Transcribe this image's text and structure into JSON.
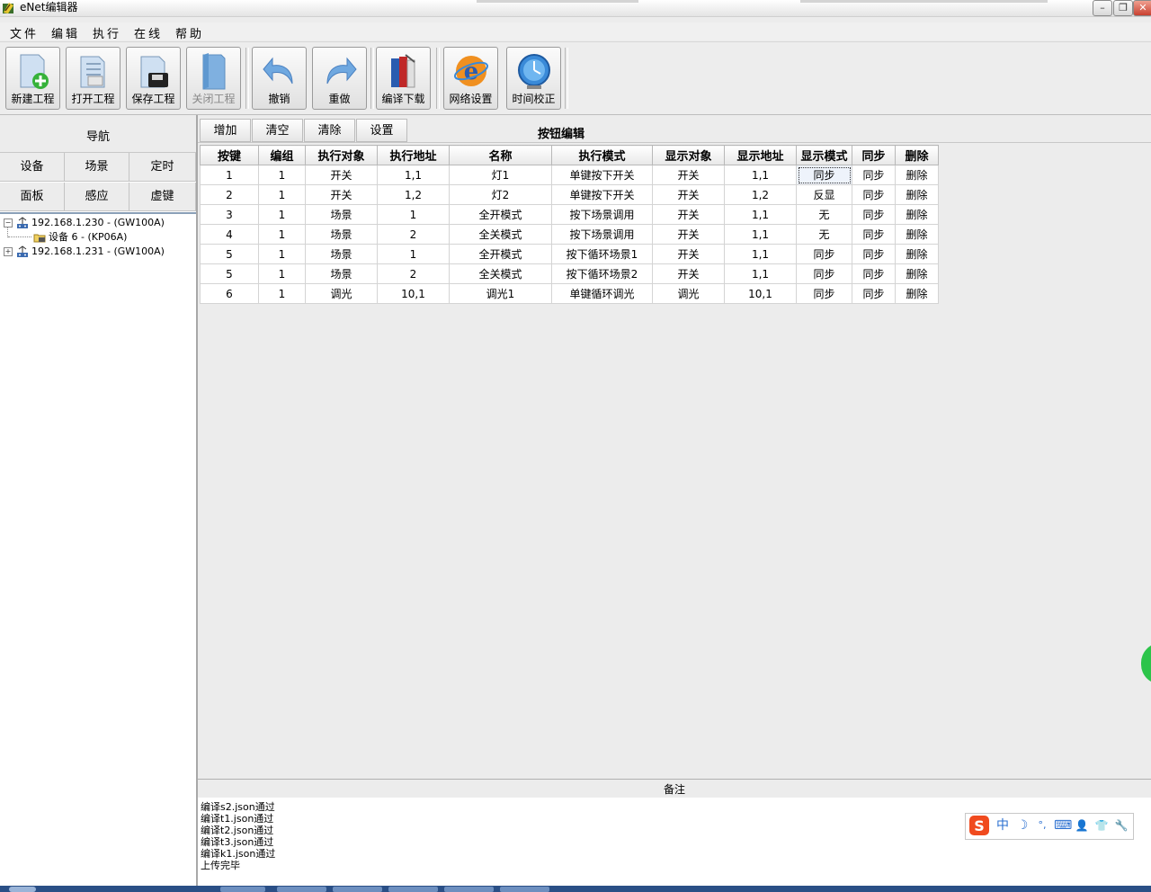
{
  "window": {
    "title": "eNet编辑器",
    "minimize": "–",
    "restore": "❐",
    "close": "✕"
  },
  "menu": [
    "文件",
    "编辑",
    "执行",
    "在线",
    "帮助"
  ],
  "toolbar": [
    {
      "label": "新建工程",
      "icon": "new-project-icon",
      "enabled": true
    },
    {
      "label": "打开工程",
      "icon": "open-project-icon",
      "enabled": true
    },
    {
      "label": "保存工程",
      "icon": "save-project-icon",
      "enabled": true
    },
    {
      "label": "关闭工程",
      "icon": "close-project-icon",
      "enabled": false
    },
    {
      "label": "撤销",
      "icon": "undo-icon",
      "enabled": true
    },
    {
      "label": "重做",
      "icon": "redo-icon",
      "enabled": true
    },
    {
      "label": "编译下载",
      "icon": "compile-download-icon",
      "enabled": true
    },
    {
      "label": "网络设置",
      "icon": "network-settings-icon",
      "enabled": true
    },
    {
      "label": "时间校正",
      "icon": "time-calibration-icon",
      "enabled": true
    }
  ],
  "nav": {
    "title": "导航",
    "buttons": [
      "设备",
      "场景",
      "定时",
      "面板",
      "感应",
      "虚键"
    ]
  },
  "tree": [
    {
      "label": "192.168.1.230 - (GW100A)",
      "expander": "−",
      "icon": "gateway-icon"
    },
    {
      "label": "设备 6 - (KP06A)",
      "icon": "device-folder-icon"
    },
    {
      "label": "192.168.1.231 - (GW100A)",
      "expander": "+",
      "icon": "gateway-icon"
    }
  ],
  "editor": {
    "tabs": [
      "增加",
      "清空",
      "清除",
      "设置"
    ],
    "title": "按钮编辑",
    "columns": [
      "按键",
      "编组",
      "执行对象",
      "执行地址",
      "名称",
      "执行模式",
      "显示对象",
      "显示地址",
      "显示模式",
      "同步",
      "删除"
    ],
    "rows": [
      [
        "1",
        "1",
        "开关",
        "1,1",
        "灯1",
        "单键按下开关",
        "开关",
        "1,1",
        "同步",
        "同步",
        "删除"
      ],
      [
        "2",
        "1",
        "开关",
        "1,2",
        "灯2",
        "单键按下开关",
        "开关",
        "1,2",
        "反显",
        "同步",
        "删除"
      ],
      [
        "3",
        "1",
        "场景",
        "1",
        "全开模式",
        "按下场景调用",
        "开关",
        "1,1",
        "无",
        "同步",
        "删除"
      ],
      [
        "4",
        "1",
        "场景",
        "2",
        "全关模式",
        "按下场景调用",
        "开关",
        "1,1",
        "无",
        "同步",
        "删除"
      ],
      [
        "5",
        "1",
        "场景",
        "1",
        "全开模式",
        "按下循环场景1",
        "开关",
        "1,1",
        "同步",
        "同步",
        "删除"
      ],
      [
        "5",
        "1",
        "场景",
        "2",
        "全关模式",
        "按下循环场景2",
        "开关",
        "1,1",
        "同步",
        "同步",
        "删除"
      ],
      [
        "6",
        "1",
        "调光",
        "10,1",
        "调光1",
        "单键循环调光",
        "调光",
        "10,1",
        "同步",
        "同步",
        "删除"
      ]
    ]
  },
  "notes": {
    "title": "备注",
    "log": [
      "编译s2.json通过",
      "编译t1.json通过",
      "编译t2.json通过",
      "编译t3.json通过",
      "编译k1.json通过",
      "上传完毕"
    ]
  },
  "ime": {
    "icons": [
      {
        "name": "sogou-logo-icon",
        "glyph": "S"
      },
      {
        "name": "chinese-mode-icon",
        "glyph": "中"
      },
      {
        "name": "half-width-moon-icon",
        "glyph": "☽"
      },
      {
        "name": "punctuation-icon",
        "glyph": "°,"
      },
      {
        "name": "keyboard-icon",
        "glyph": "⌨"
      },
      {
        "name": "user-icon",
        "glyph": "👤"
      },
      {
        "name": "skin-shirt-icon",
        "glyph": "👕"
      },
      {
        "name": "tools-wrench-icon",
        "glyph": "🔧"
      }
    ]
  },
  "colors": {
    "accent_green": "#2cc44a",
    "taskbar": "#2a4f86",
    "tree_border": "#8aa0b8"
  }
}
